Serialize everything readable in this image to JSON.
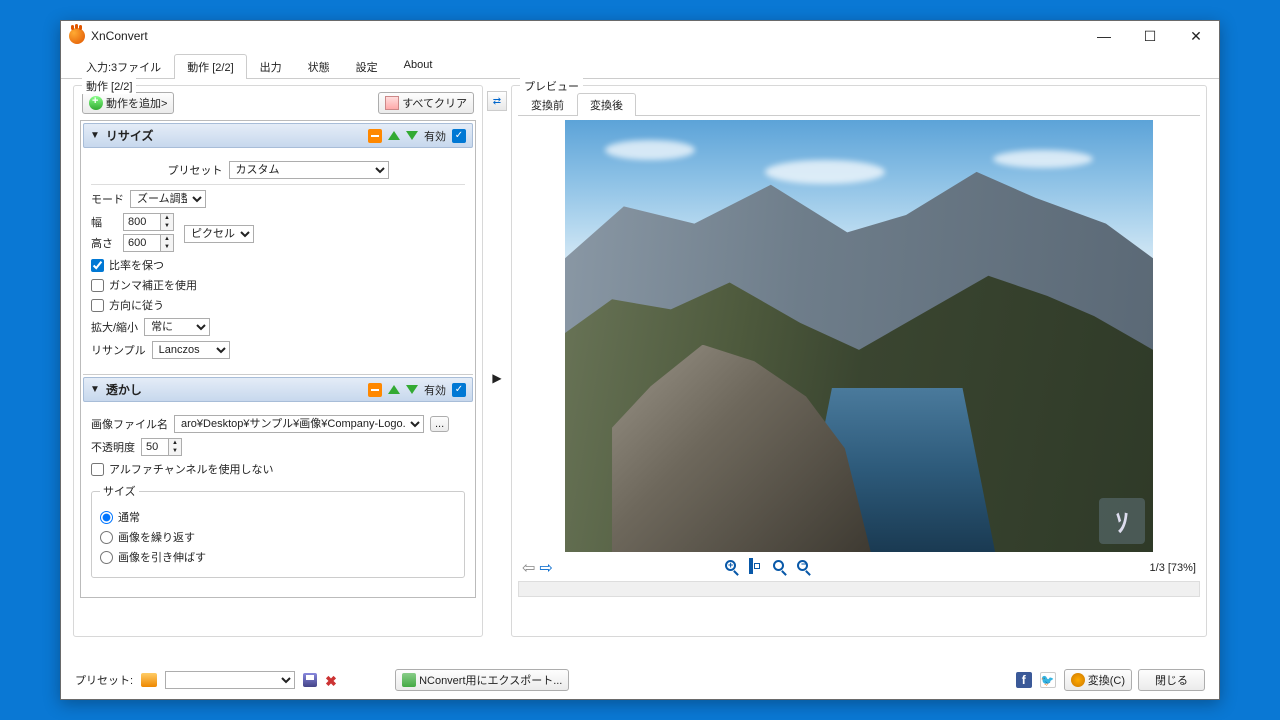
{
  "window": {
    "title": "XnConvert"
  },
  "winbtns": {
    "min": "—",
    "max": "☐",
    "close": "✕"
  },
  "tabs": {
    "input": "入力:3ファイル",
    "action": "動作 [2/2]",
    "output": "出力",
    "status": "状態",
    "settings": "設定",
    "about": "About"
  },
  "left": {
    "panel_label": "動作 [2/2]",
    "add_action": "動作を追加>",
    "clear_all": "すべてクリア",
    "valid_label": "有効"
  },
  "resize": {
    "title": "リサイズ",
    "preset_label": "プリセット",
    "preset_value": "カスタム",
    "mode_label": "モード",
    "mode_value": "ズーム調整",
    "width_label": "幅",
    "width_value": "800",
    "height_label": "高さ",
    "height_value": "600",
    "unit_value": "ピクセル",
    "keep_ratio": "比率を保つ",
    "gamma": "ガンマ補正を使用",
    "orientation": "方向に従う",
    "enlarge_label": "拡大/縮小",
    "enlarge_value": "常に",
    "resample_label": "リサンプル",
    "resample_value": "Lanczos"
  },
  "watermark": {
    "title": "透かし",
    "file_label": "画像ファイル名",
    "file_value": "aro¥Desktop¥サンプル¥画像¥Company-Logo.png",
    "browse": "...",
    "opacity_label": "不透明度",
    "opacity_value": "50",
    "no_alpha": "アルファチャンネルを使用しない",
    "size_legend": "サイズ",
    "size_normal": "通常",
    "size_tile": "画像を繰り返す",
    "size_stretch": "画像を引き伸ばす"
  },
  "preview": {
    "panel_label": "プレビュー",
    "before": "変換前",
    "after": "変換後",
    "status": "1/3 [73%]"
  },
  "footer": {
    "preset_label": "プリセット:",
    "export": "NConvert用にエクスポート...",
    "convert": "変換(C)",
    "close": "閉じる"
  }
}
